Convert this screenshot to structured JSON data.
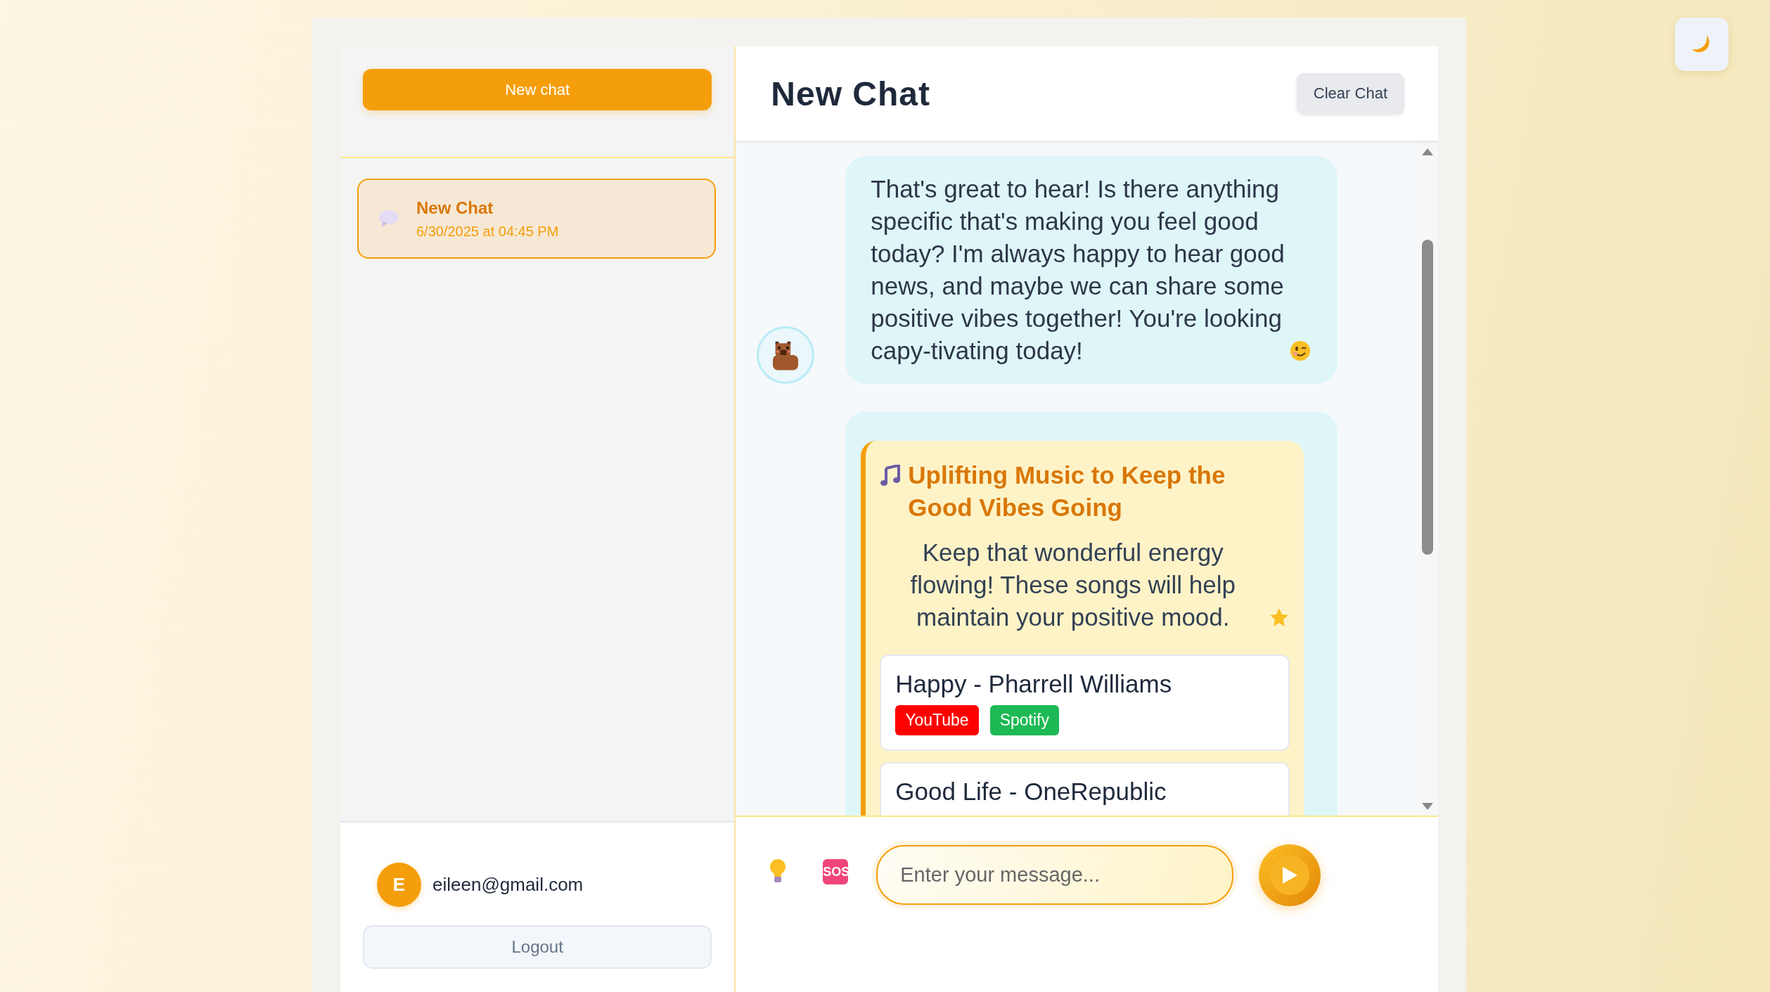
{
  "sidebar": {
    "new_chat_button": "New chat",
    "chats": [
      {
        "title": "New Chat",
        "timestamp": "6/30/2025 at 04:45 PM",
        "selected": true
      }
    ],
    "user": {
      "initial": "E",
      "email": "eileen@gmail.com"
    },
    "logout_button": "Logout"
  },
  "chat": {
    "title": "New Chat",
    "clear_button": "Clear Chat",
    "messages": [
      {
        "kind": "text",
        "avatar": true,
        "text": "That's great to hear! Is there anything specific that's making you feel good today? I'm always happy to hear good news, and maybe we can share some positive vibes together! You're looking capy-tivating today!"
      },
      {
        "kind": "music",
        "avatar": false,
        "title": "Uplifting Music to Keep the Good Vibes Going",
        "intro": "Keep that wonderful energy flowing! These songs will help maintain your positive mood.",
        "songs": [
          {
            "title": "Happy - Pharrell Williams",
            "links": [
              {
                "label": "YouTube",
                "color": "#ff0000"
              },
              {
                "label": "Spotify",
                "color": "#1db954"
              }
            ]
          },
          {
            "title": "Good Life - OneRepublic"
          }
        ]
      }
    ],
    "composer": {
      "sos_label": "SOS",
      "placeholder": "Enter your message..."
    }
  }
}
